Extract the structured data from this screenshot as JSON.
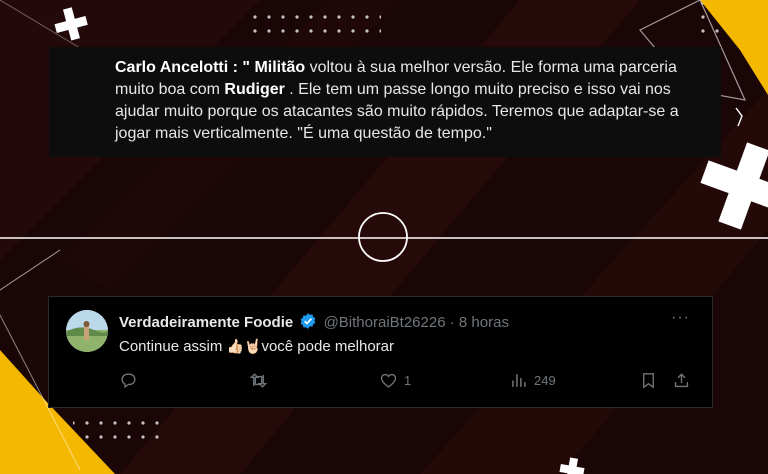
{
  "quote": {
    "speaker": "Carlo Ancelotti",
    "sep1": " : \" ",
    "player1": "Militão",
    "text1": " voltou à sua melhor versão. Ele forma uma parceria muito boa com ",
    "player2": "Rudiger",
    "text2": " . Ele tem um passe longo muito preciso e isso vai nos ajudar muito porque os atacantes são muito rápidos. Teremos que adaptar-se a jogar mais verticalmente. \"É uma questão de tempo.\""
  },
  "tweet": {
    "display_name": "Verdadeiramente Foodie",
    "handle": "@BithoraiBt26226",
    "dot": "·",
    "time": "8 horas",
    "more": "···",
    "text_before": "Continue assim ",
    "emojis": "👍🏻🤘🏻",
    "text_after": "você pode melhorar",
    "actions": {
      "reply_icon": "reply-icon",
      "retweet_icon": "retweet-icon",
      "like_icon": "heart-icon",
      "like_count": "1",
      "views_icon": "views-icon",
      "views_count": "249",
      "bookmark_icon": "bookmark-icon",
      "share_icon": "share-icon"
    },
    "verified_color": "#1d9bf0"
  },
  "colors": {
    "accent_yellow": "#f5b800",
    "background": "#1a0606"
  }
}
